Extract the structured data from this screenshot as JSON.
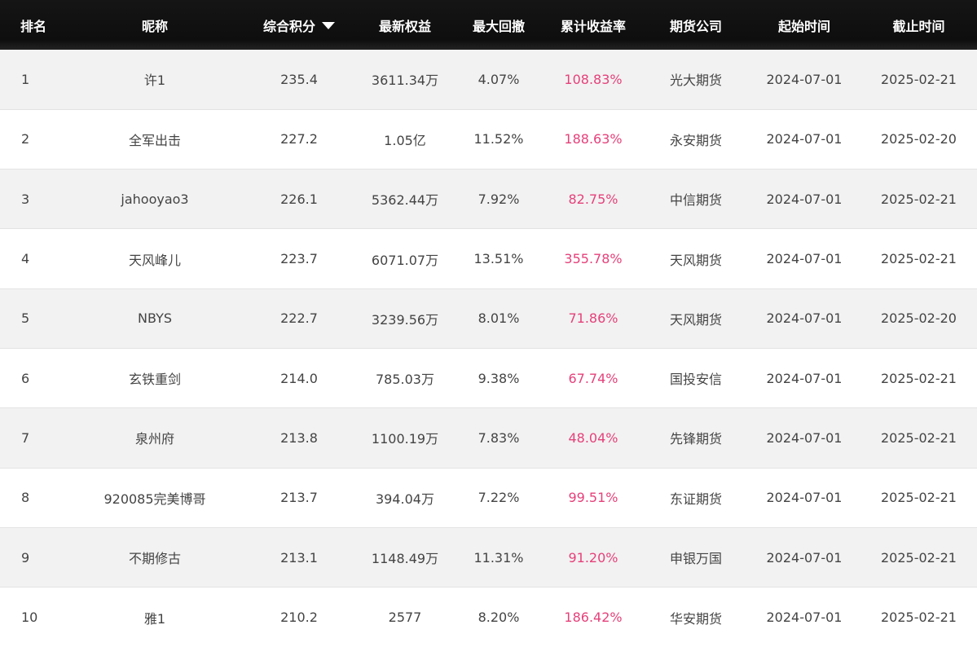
{
  "colors": {
    "header_bg": "#111111",
    "header_text": "#ffffff",
    "row_alt_bg": "#f2f2f2",
    "text": "#444444",
    "return_highlight": "#e5417a"
  },
  "table": {
    "headers": {
      "rank": "排名",
      "nickname": "昵称",
      "score": "综合积分",
      "equity": "最新权益",
      "drawdown": "最大回撤",
      "return": "累计收益率",
      "company": "期货公司",
      "start": "起始时间",
      "end": "截止时间"
    },
    "sort_icon": "triangle-down-icon",
    "rows": [
      {
        "rank": "1",
        "nickname": "许1",
        "score": "235.4",
        "equity": "3611.34万",
        "drawdown": "4.07%",
        "return": "108.83%",
        "company": "光大期货",
        "start": "2024-07-01",
        "end": "2025-02-21"
      },
      {
        "rank": "2",
        "nickname": "全军出击",
        "score": "227.2",
        "equity": "1.05亿",
        "drawdown": "11.52%",
        "return": "188.63%",
        "company": "永安期货",
        "start": "2024-07-01",
        "end": "2025-02-20"
      },
      {
        "rank": "3",
        "nickname": "jahooyao3",
        "score": "226.1",
        "equity": "5362.44万",
        "drawdown": "7.92%",
        "return": "82.75%",
        "company": "中信期货",
        "start": "2024-07-01",
        "end": "2025-02-21"
      },
      {
        "rank": "4",
        "nickname": "天风峰儿",
        "score": "223.7",
        "equity": "6071.07万",
        "drawdown": "13.51%",
        "return": "355.78%",
        "company": "天风期货",
        "start": "2024-07-01",
        "end": "2025-02-21"
      },
      {
        "rank": "5",
        "nickname": "NBYS",
        "score": "222.7",
        "equity": "3239.56万",
        "drawdown": "8.01%",
        "return": "71.86%",
        "company": "天风期货",
        "start": "2024-07-01",
        "end": "2025-02-20"
      },
      {
        "rank": "6",
        "nickname": "玄铁重剑",
        "score": "214.0",
        "equity": "785.03万",
        "drawdown": "9.38%",
        "return": "67.74%",
        "company": "国投安信",
        "start": "2024-07-01",
        "end": "2025-02-21"
      },
      {
        "rank": "7",
        "nickname": "泉州府",
        "score": "213.8",
        "equity": "1100.19万",
        "drawdown": "7.83%",
        "return": "48.04%",
        "company": "先锋期货",
        "start": "2024-07-01",
        "end": "2025-02-21"
      },
      {
        "rank": "8",
        "nickname": "920085完美博哥",
        "score": "213.7",
        "equity": "394.04万",
        "drawdown": "7.22%",
        "return": "99.51%",
        "company": "东证期货",
        "start": "2024-07-01",
        "end": "2025-02-21"
      },
      {
        "rank": "9",
        "nickname": "不期修古",
        "score": "213.1",
        "equity": "1148.49万",
        "drawdown": "11.31%",
        "return": "91.20%",
        "company": "申银万国",
        "start": "2024-07-01",
        "end": "2025-02-21"
      },
      {
        "rank": "10",
        "nickname": "雅1",
        "score": "210.2",
        "equity": "2577",
        "drawdown": "8.20%",
        "return": "186.42%",
        "company": "华安期货",
        "start": "2024-07-01",
        "end": "2025-02-21"
      }
    ]
  }
}
